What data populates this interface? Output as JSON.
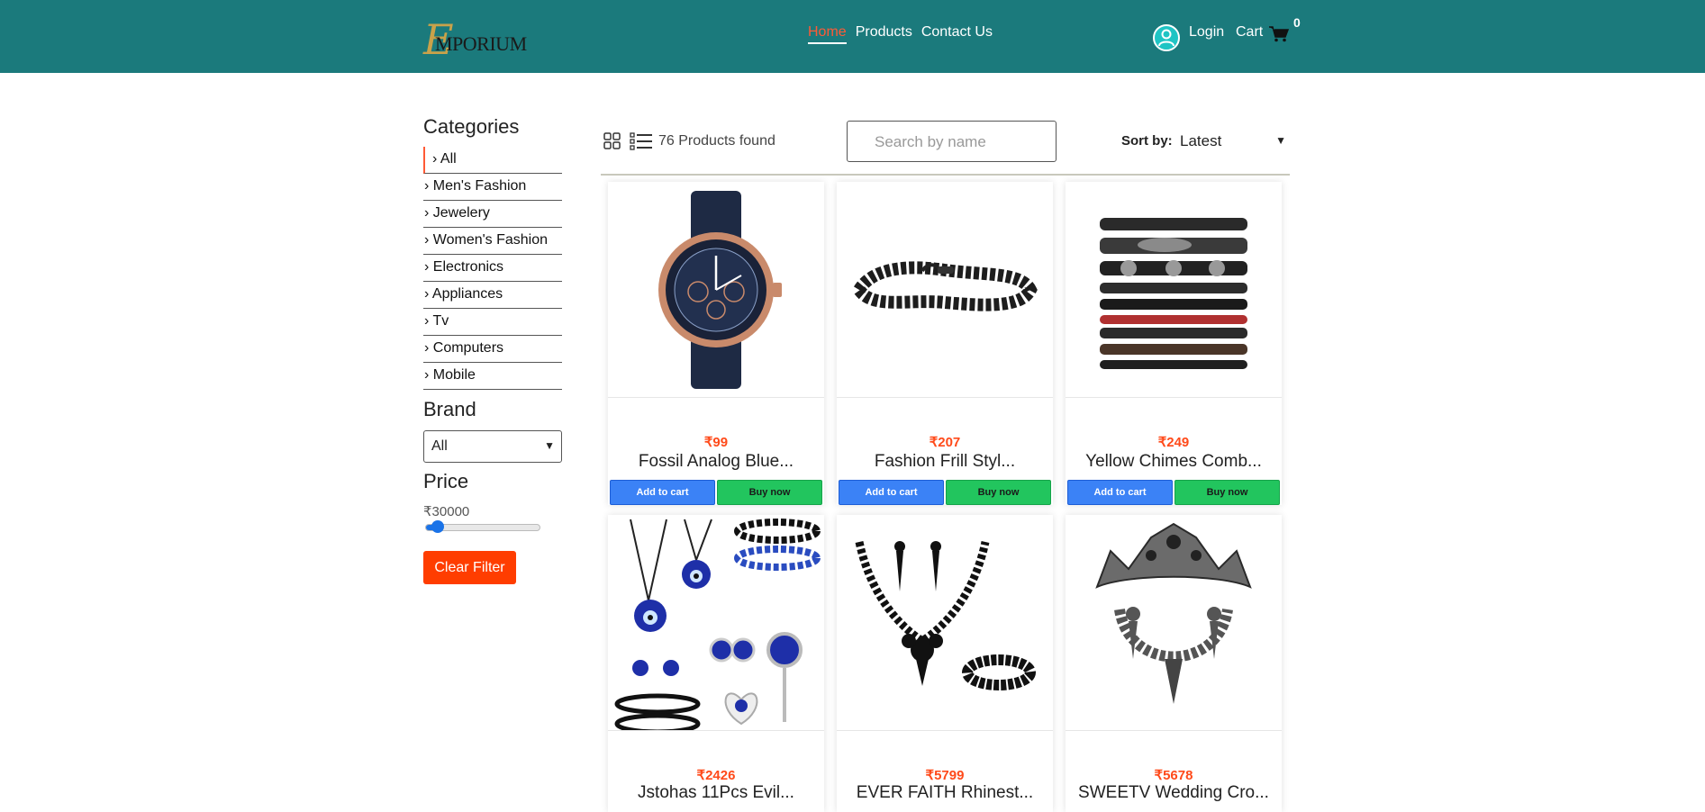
{
  "header": {
    "logo_initial": "E",
    "logo_text": "MPORIUM",
    "nav": [
      "Home",
      "Products",
      "Contact Us"
    ],
    "login": "Login",
    "cart": "Cart",
    "cart_count": "0"
  },
  "sidebar": {
    "categories_title": "Categories",
    "categories": [
      "› All",
      "› Men's Fashion",
      "› Jewelery",
      "› Women's Fashion",
      "› Electronics",
      "› Appliances",
      "› Tv",
      "› Computers",
      "› Mobile"
    ],
    "brand_title": "Brand",
    "brand_selected": "All",
    "price_title": "Price",
    "price_value": "₹30000",
    "price_fraction": 0.08,
    "clear_label": "Clear Filter"
  },
  "toolbar": {
    "found": "76 Products found",
    "search_placeholder": "Search by name",
    "sort_label": "Sort by:",
    "sort_selected": "Latest"
  },
  "products": [
    {
      "price": "₹99",
      "name": "Fossil Analog Blue...",
      "add": "Add to cart",
      "buy": "Buy now",
      "image": "watch"
    },
    {
      "price": "₹207",
      "name": "Fashion Frill Styl...",
      "add": "Add to cart",
      "buy": "Buy now",
      "image": "chain-bracelet"
    },
    {
      "price": "₹249",
      "name": "Yellow Chimes Comb...",
      "add": "Add to cart",
      "buy": "Buy now",
      "image": "leather-bracelets"
    },
    {
      "price": "₹2426",
      "name": "Jstohas 11Pcs Evil...",
      "image": "evil-eye-jewelry"
    },
    {
      "price": "₹5799",
      "name": "EVER FAITH Rhinest...",
      "image": "necklace-set"
    },
    {
      "price": "₹5678",
      "name": "SWEETV Wedding Cro...",
      "image": "tiara-set"
    }
  ],
  "colors": {
    "header": "#1b7a7c",
    "accent": "#ff5a36",
    "add_to_cart": "#3b82f6",
    "buy_now": "#22c55e",
    "clear": "#ff3d00"
  }
}
